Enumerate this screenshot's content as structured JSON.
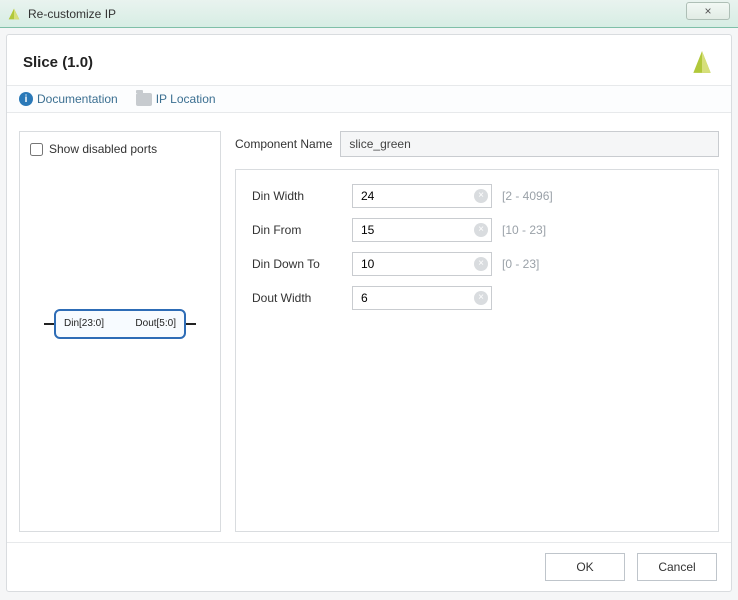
{
  "window": {
    "title": "Re-customize IP",
    "close_glyph": "×"
  },
  "header": {
    "title": "Slice (1.0)"
  },
  "links": {
    "documentation": "Documentation",
    "ip_location": "IP Location"
  },
  "left": {
    "show_disabled_label": "Show disabled ports",
    "block_in": "Din[23:0]",
    "block_out": "Dout[5:0]"
  },
  "form": {
    "component_name_label": "Component Name",
    "component_name_value": "slice_green",
    "params": [
      {
        "label": "Din Width",
        "value": "24",
        "range": "[2 - 4096]"
      },
      {
        "label": "Din From",
        "value": "15",
        "range": "[10 - 23]"
      },
      {
        "label": "Din Down To",
        "value": "10",
        "range": "[0 - 23]"
      },
      {
        "label": "Dout Width",
        "value": "6",
        "range": ""
      }
    ]
  },
  "buttons": {
    "ok": "OK",
    "cancel": "Cancel"
  }
}
